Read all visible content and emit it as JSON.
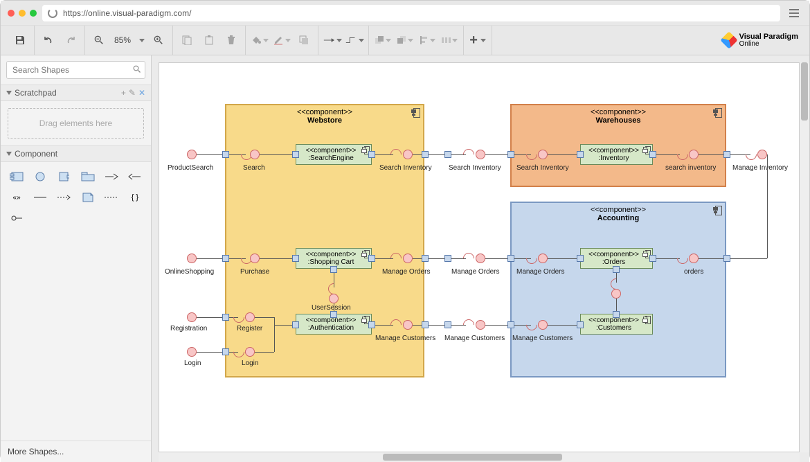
{
  "browser": {
    "url": "https://online.visual-paradigm.com/"
  },
  "toolbar": {
    "zoom_pct": "85%"
  },
  "brand": {
    "name": "Visual Paradigm",
    "sub": "Online"
  },
  "sidebar": {
    "search_placeholder": "Search Shapes",
    "scratchpad_label": "Scratchpad",
    "drop_hint": "Drag elements here",
    "component_label": "Component",
    "more_shapes": "More Shapes..."
  },
  "diagram": {
    "containers": {
      "webstore": {
        "stereotype": "<<component>>",
        "name": "Webstore"
      },
      "warehouses": {
        "stereotype": "<<component>>",
        "name": "Warehouses"
      },
      "accounting": {
        "stereotype": "<<component>>",
        "name": "Accounting"
      }
    },
    "components": {
      "search_engine": {
        "stereotype": "<<component>>",
        "name": ":SearchEngine"
      },
      "shopping_cart": {
        "stereotype": "<<component>>",
        "name": ":Shopping Cart"
      },
      "authentication": {
        "stereotype": "<<component>>",
        "name": ":Authentication"
      },
      "inventory": {
        "stereotype": "<<component>>",
        "name": ":Inventory"
      },
      "orders": {
        "stereotype": "<<component>>",
        "name": ":Orders"
      },
      "customers": {
        "stereotype": "<<component>>",
        "name": ":Customers"
      }
    },
    "labels": {
      "product_search": "ProductSearch",
      "search": "Search",
      "search_inventory": "Search Inventory",
      "search_inventory2": "Search Inventory",
      "search_inventory3": "Search Inventory",
      "search_inventory_lc": "search inventory",
      "manage_inventory": "Manage Inventory",
      "online_shopping": "OnlineShopping",
      "purchase": "Purchase",
      "manage_orders": "Manage Orders",
      "manage_orders2": "Manage Orders",
      "manage_orders3": "Manage Orders",
      "orders_lbl": "orders",
      "user_session": "UserSession",
      "registration": "Registration",
      "register": "Register",
      "login": "Login",
      "login2": "Login",
      "manage_customers": "Manage Customers",
      "manage_customers2": "Manage Customers",
      "manage_customers3": "Manage Customers"
    }
  }
}
